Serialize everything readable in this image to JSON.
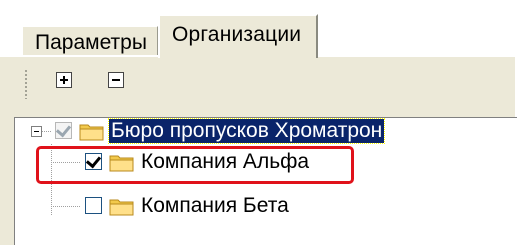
{
  "tabs": [
    {
      "label": "Параметры",
      "active": false
    },
    {
      "label": "Организации",
      "active": true
    }
  ],
  "toolbar": {
    "expand_icon": "plus-box-icon",
    "collapse_icon": "minus-box-icon"
  },
  "tree": {
    "root": {
      "label": "Бюро пропусков Хроматрон",
      "checked": true,
      "expanded": true,
      "selected": true
    },
    "children": [
      {
        "label": "Компания Альфа",
        "checked": true,
        "highlighted": true
      },
      {
        "label": "Компания Бета",
        "checked": false
      }
    ]
  },
  "colors": {
    "selection": "#0a246a",
    "highlight_border": "#e0121a",
    "panel": "#ece9d8"
  }
}
